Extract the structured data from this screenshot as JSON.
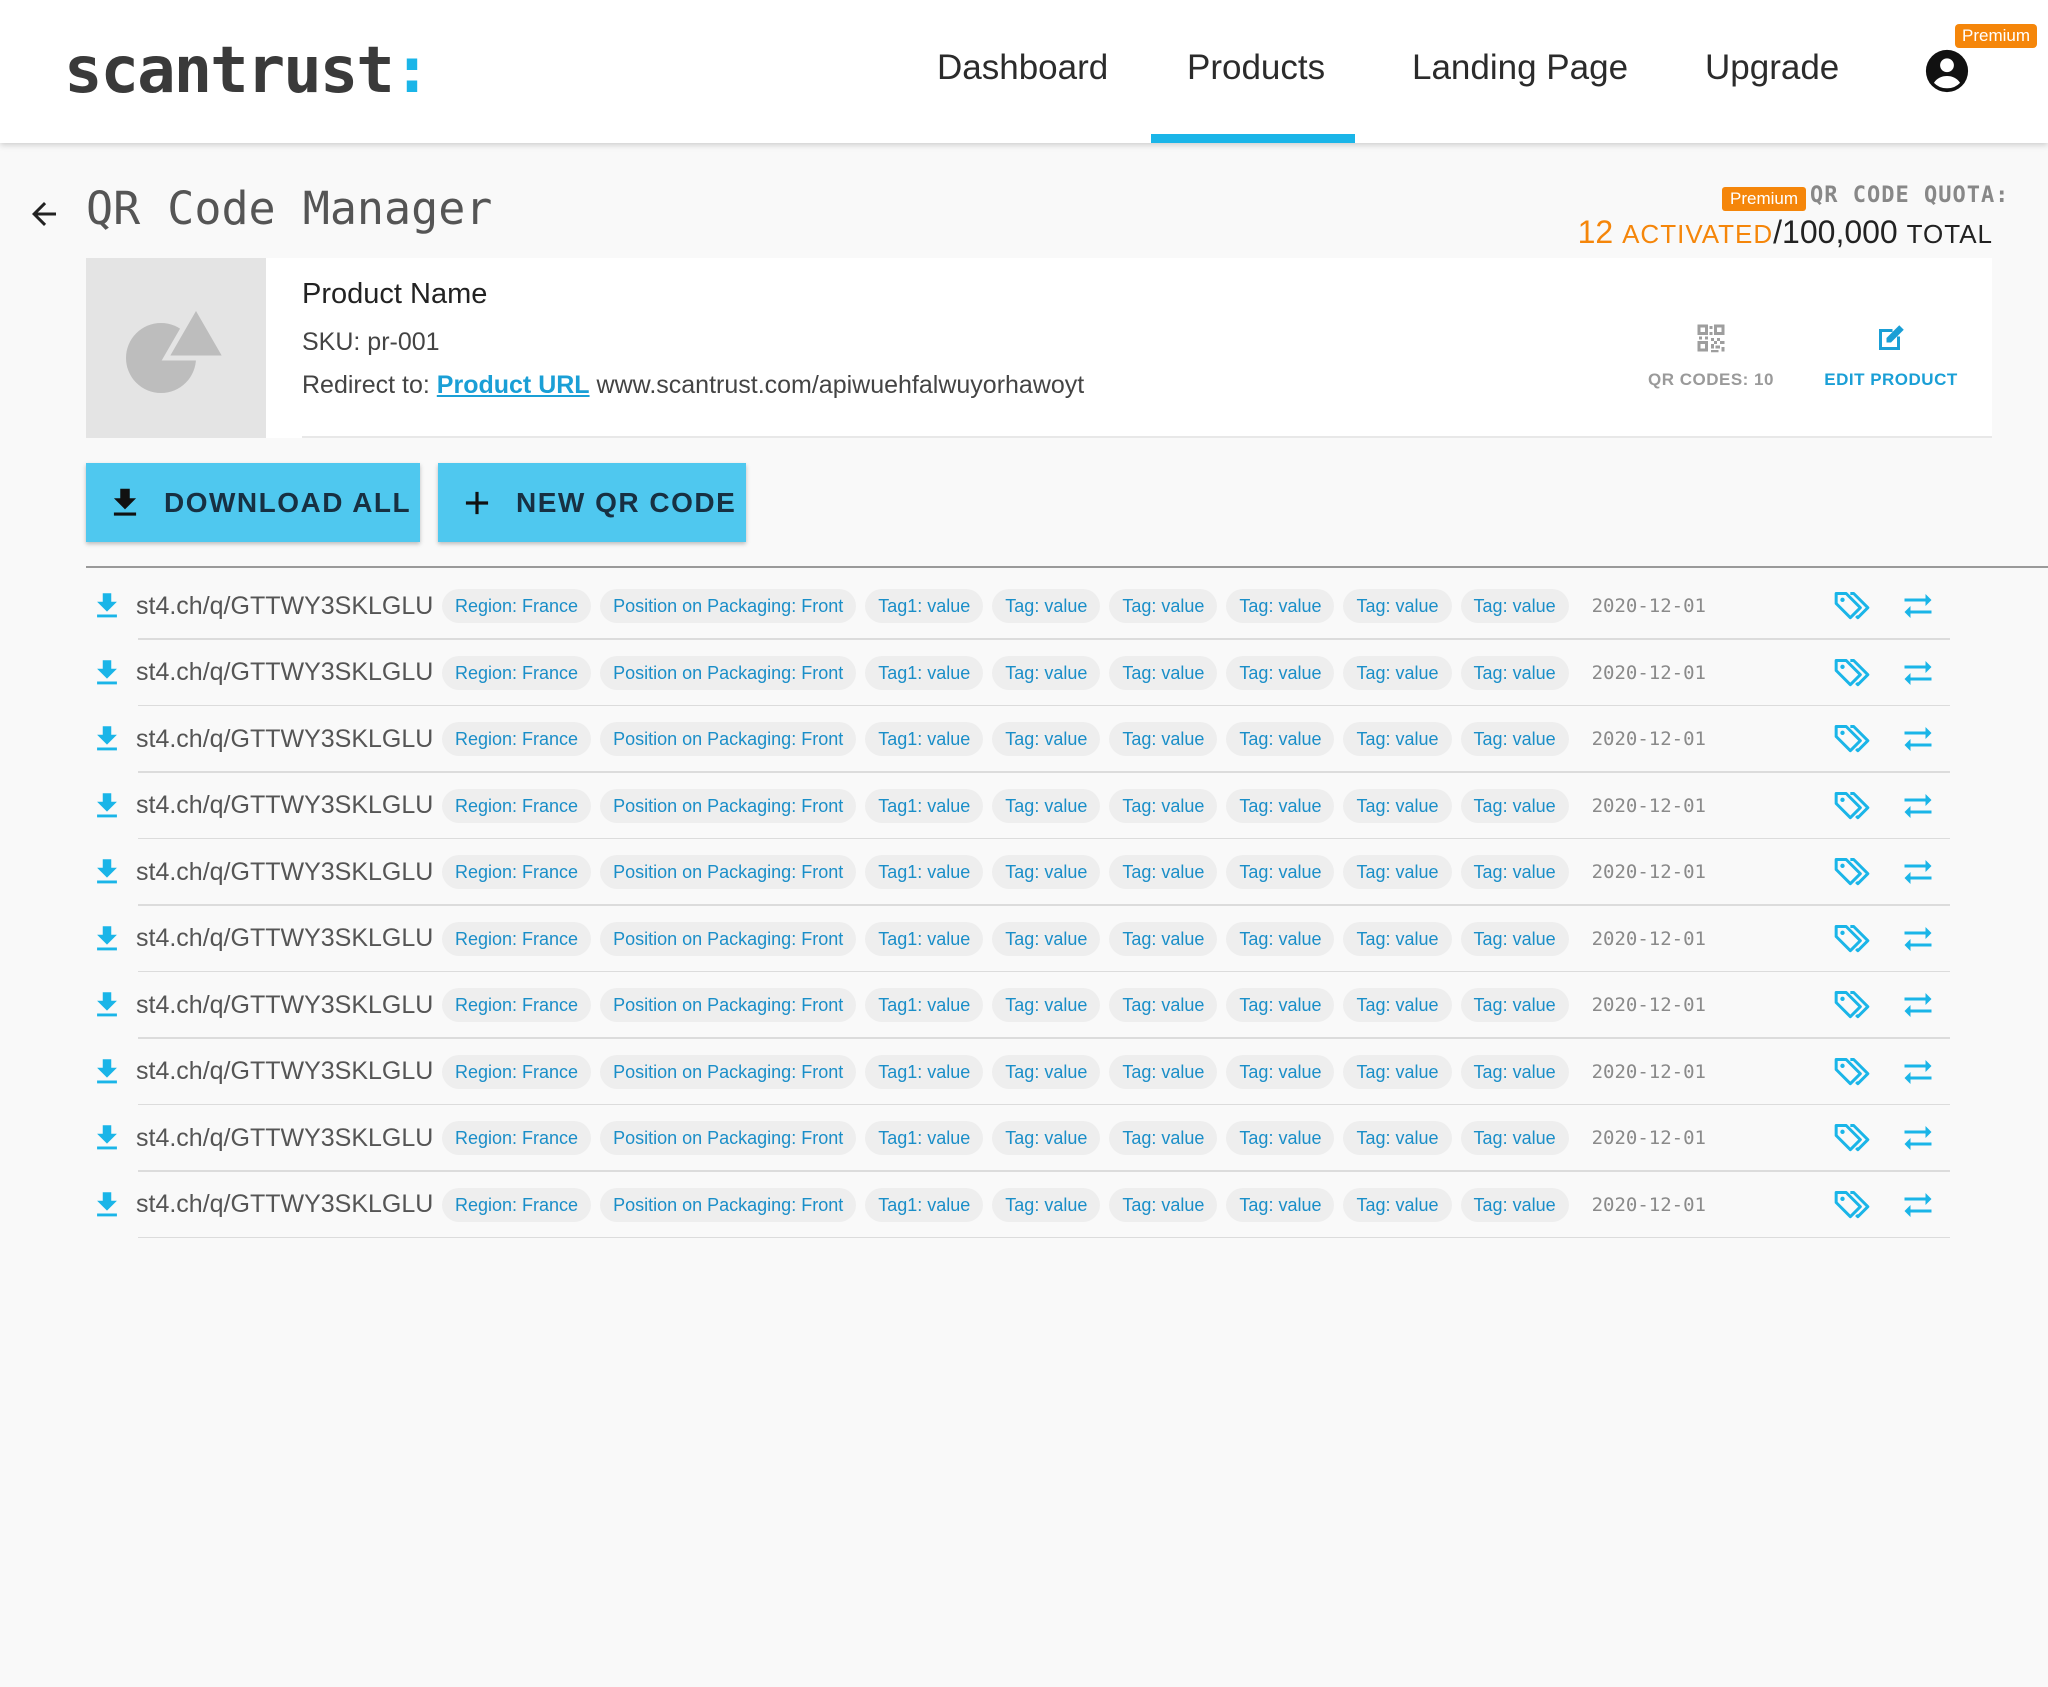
{
  "colors": {
    "accent": "#1ab5e8",
    "button": "#4fc8ef",
    "premium": "#f5860a",
    "link": "#1a9fd6"
  },
  "header": {
    "logo_text": "scantrust",
    "logo_colon": ":",
    "nav": [
      "Dashboard",
      "Products",
      "Landing Page",
      "Upgrade"
    ],
    "active_nav": "Products",
    "premium_badge": "Premium",
    "avatar_icon": "account-circle-icon"
  },
  "page": {
    "title": "QR Code Manager",
    "back_icon": "arrow-left-icon",
    "quota": {
      "premium_badge": "Premium",
      "label": "QR CODE QUOTA:",
      "activated_count": "12",
      "activated_word": "ACTIVATED",
      "total_count": "/100,000",
      "total_word": "TOTAL"
    }
  },
  "product": {
    "name": "Product Name",
    "sku": "SKU: pr-001",
    "redirect_prefix": "Redirect to:",
    "redirect_link": "Product URL",
    "redirect_url": "www.scantrust.com/apiwuehfalwuyorhawoyt",
    "qr_codes_label": "QR CODES: 10",
    "edit_label": "EDIT PRODUCT"
  },
  "actions": {
    "download_all": "DOWNLOAD ALL",
    "new_qr_code": "NEW QR CODE"
  },
  "rows": [
    {
      "url": "st4.ch/q/GTTWY3SKLGLU",
      "tags": [
        "Region: France",
        "Position on Packaging: Front",
        "Tag1: value",
        "Tag: value",
        "Tag: value",
        "Tag: value",
        "Tag: value",
        "Tag: value"
      ],
      "date": "2020-12-01"
    },
    {
      "url": "st4.ch/q/GTTWY3SKLGLU",
      "tags": [
        "Region: France",
        "Position on Packaging: Front",
        "Tag1: value",
        "Tag: value",
        "Tag: value",
        "Tag: value",
        "Tag: value",
        "Tag: value"
      ],
      "date": "2020-12-01"
    },
    {
      "url": "st4.ch/q/GTTWY3SKLGLU",
      "tags": [
        "Region: France",
        "Position on Packaging: Front",
        "Tag1: value",
        "Tag: value",
        "Tag: value",
        "Tag: value",
        "Tag: value",
        "Tag: value"
      ],
      "date": "2020-12-01"
    },
    {
      "url": "st4.ch/q/GTTWY3SKLGLU",
      "tags": [
        "Region: France",
        "Position on Packaging: Front",
        "Tag1: value",
        "Tag: value",
        "Tag: value",
        "Tag: value",
        "Tag: value",
        "Tag: value"
      ],
      "date": "2020-12-01"
    },
    {
      "url": "st4.ch/q/GTTWY3SKLGLU",
      "tags": [
        "Region: France",
        "Position on Packaging: Front",
        "Tag1: value",
        "Tag: value",
        "Tag: value",
        "Tag: value",
        "Tag: value",
        "Tag: value"
      ],
      "date": "2020-12-01"
    },
    {
      "url": "st4.ch/q/GTTWY3SKLGLU",
      "tags": [
        "Region: France",
        "Position on Packaging: Front",
        "Tag1: value",
        "Tag: value",
        "Tag: value",
        "Tag: value",
        "Tag: value",
        "Tag: value"
      ],
      "date": "2020-12-01"
    },
    {
      "url": "st4.ch/q/GTTWY3SKLGLU",
      "tags": [
        "Region: France",
        "Position on Packaging: Front",
        "Tag1: value",
        "Tag: value",
        "Tag: value",
        "Tag: value",
        "Tag: value",
        "Tag: value"
      ],
      "date": "2020-12-01"
    },
    {
      "url": "st4.ch/q/GTTWY3SKLGLU",
      "tags": [
        "Region: France",
        "Position on Packaging: Front",
        "Tag1: value",
        "Tag: value",
        "Tag: value",
        "Tag: value",
        "Tag: value",
        "Tag: value"
      ],
      "date": "2020-12-01"
    },
    {
      "url": "st4.ch/q/GTTWY3SKLGLU",
      "tags": [
        "Region: France",
        "Position on Packaging: Front",
        "Tag1: value",
        "Tag: value",
        "Tag: value",
        "Tag: value",
        "Tag: value",
        "Tag: value"
      ],
      "date": "2020-12-01"
    },
    {
      "url": "st4.ch/q/GTTWY3SKLGLU",
      "tags": [
        "Region: France",
        "Position on Packaging: Front",
        "Tag1: value",
        "Tag: value",
        "Tag: value",
        "Tag: value",
        "Tag: value",
        "Tag: value"
      ],
      "date": "2020-12-01"
    }
  ]
}
